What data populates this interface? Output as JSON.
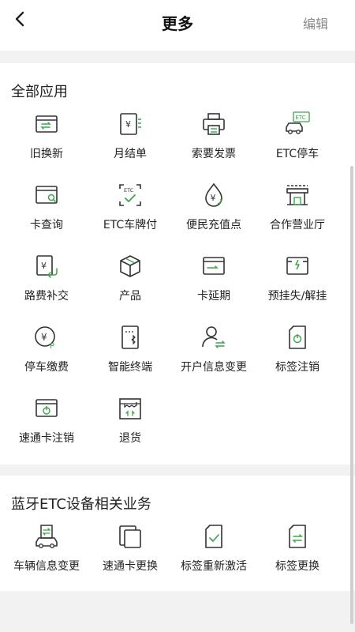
{
  "header": {
    "title": "更多",
    "edit_label": "编辑"
  },
  "all_apps": {
    "title": "全部应用",
    "items": [
      {
        "label": "旧换新",
        "icon": "card-exchange-icon"
      },
      {
        "label": "月结单",
        "icon": "monthly-statement-icon"
      },
      {
        "label": "索要发票",
        "icon": "printer-icon"
      },
      {
        "label": "ETC停车",
        "icon": "etc-parking-icon"
      },
      {
        "label": "卡查询",
        "icon": "card-search-icon"
      },
      {
        "label": "ETC车牌付",
        "icon": "etc-plate-pay-icon"
      },
      {
        "label": "便民充值点",
        "icon": "recharge-point-icon"
      },
      {
        "label": "合作营业厅",
        "icon": "service-hall-icon"
      },
      {
        "label": "路费补交",
        "icon": "toll-repay-icon"
      },
      {
        "label": "产品",
        "icon": "product-box-icon"
      },
      {
        "label": "卡延期",
        "icon": "card-extend-icon"
      },
      {
        "label": "预挂失/解挂",
        "icon": "report-loss-icon"
      },
      {
        "label": "停车缴费",
        "icon": "parking-fee-icon"
      },
      {
        "label": "智能终端",
        "icon": "smart-terminal-icon"
      },
      {
        "label": "开户信息变更",
        "icon": "account-change-icon"
      },
      {
        "label": "标签注销",
        "icon": "tag-cancel-icon"
      },
      {
        "label": "速通卡注销",
        "icon": "card-cancel-icon"
      },
      {
        "label": "退货",
        "icon": "return-goods-icon"
      }
    ]
  },
  "bluetooth": {
    "title": "蓝牙ETC设备相关业务",
    "items": [
      {
        "label": "车辆信息变更",
        "icon": "vehicle-change-icon"
      },
      {
        "label": "速通卡更换",
        "icon": "card-replace-icon"
      },
      {
        "label": "标签重新激活",
        "icon": "tag-reactivate-icon"
      },
      {
        "label": "标签更换",
        "icon": "tag-replace-icon"
      }
    ]
  },
  "colors": {
    "icon_stroke": "#333333",
    "accent_green": "#3aa64a"
  }
}
